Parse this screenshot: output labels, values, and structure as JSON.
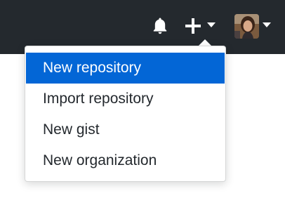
{
  "header": {
    "notifications_icon": "bell-icon",
    "create_icon": "plus-icon",
    "colors": {
      "background": "#24292e",
      "icon": "#ffffff"
    }
  },
  "menu": {
    "items": [
      {
        "label": "New repository",
        "active": true
      },
      {
        "label": "Import repository",
        "active": false
      },
      {
        "label": "New gist",
        "active": false
      },
      {
        "label": "New organization",
        "active": false
      }
    ],
    "colors": {
      "active_bg": "#0366d6",
      "active_text": "#ffffff",
      "text": "#24292e"
    }
  }
}
